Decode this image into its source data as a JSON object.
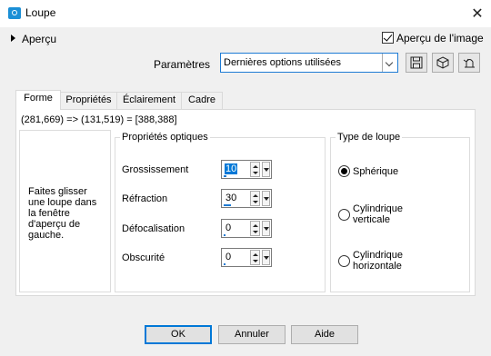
{
  "window": {
    "title": "Loupe",
    "close_glyph": "✕"
  },
  "preview": {
    "toggle_label": "Aperçu",
    "image_preview_label": "Aperçu de l'image",
    "image_preview_checked": true
  },
  "presets": {
    "label": "Paramètres",
    "selected": "Dernières options utilisées",
    "icons": [
      "save-icon",
      "load-icon",
      "reset-icon"
    ]
  },
  "tabs": [
    {
      "label": "Forme",
      "active": true
    },
    {
      "label": "Propriétés",
      "active": false
    },
    {
      "label": "Éclairement",
      "active": false
    },
    {
      "label": "Cadre",
      "active": false
    }
  ],
  "coords_text": "(281,669) => (131,519) = [388,388]",
  "instructions": "Faites glisser une loupe dans la fenêtre d'aperçu de gauche.",
  "optical": {
    "title": "Propriétés optiques",
    "fields": [
      {
        "label": "Grossissement",
        "value": "10",
        "level": 0.1
      },
      {
        "label": "Réfraction",
        "value": "30",
        "level": 0.3
      },
      {
        "label": "Défocalisation",
        "value": "0",
        "level": 0.0
      },
      {
        "label": "Obscurité",
        "value": "0",
        "level": 0.0
      }
    ]
  },
  "loupe_type": {
    "title": "Type de loupe",
    "options": [
      {
        "label": "Sphérique",
        "selected": true
      },
      {
        "label": "Cylindrique verticale",
        "selected": false
      },
      {
        "label": "Cylindrique horizontale",
        "selected": false
      }
    ]
  },
  "buttons": {
    "ok": "OK",
    "cancel": "Annuler",
    "help": "Aide"
  },
  "colors": {
    "accent": "#0078d7",
    "app_icon": "#1b8fd6"
  }
}
